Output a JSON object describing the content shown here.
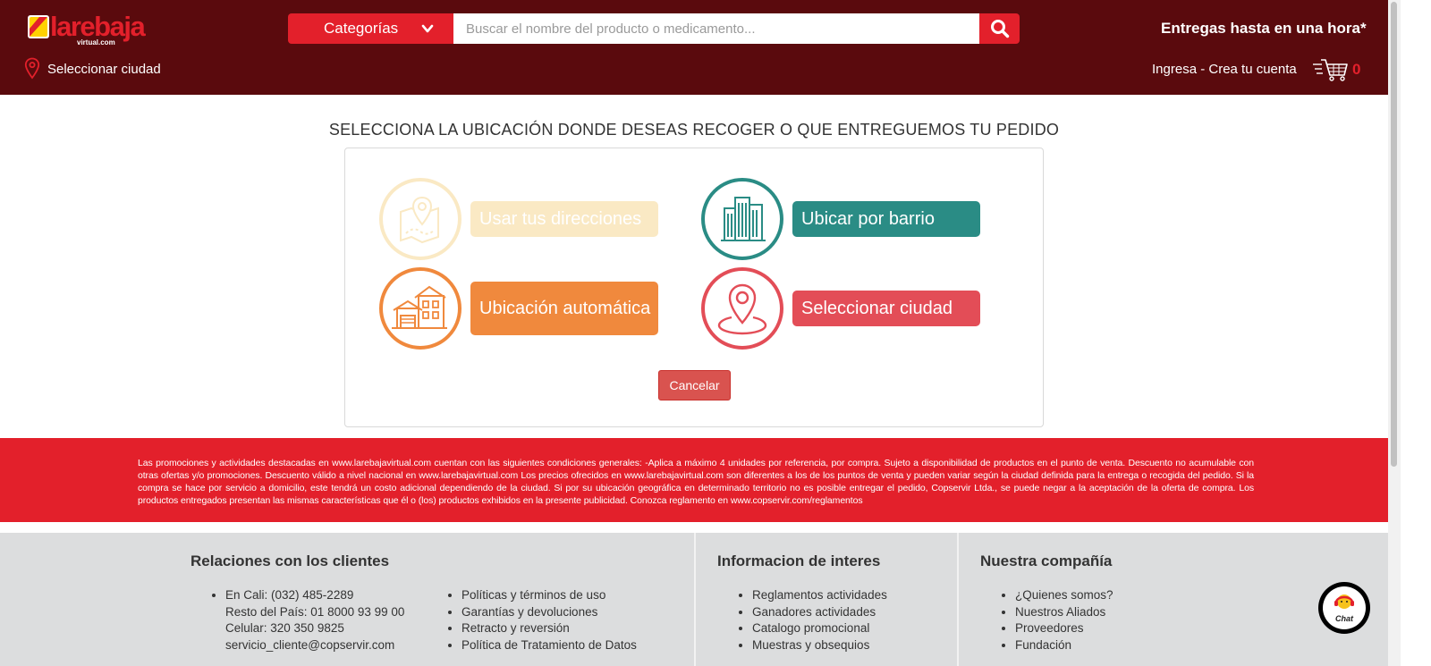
{
  "header": {
    "logo_text": "larebaja",
    "logo_sub": "virtual.com",
    "categories_label": "Categorías",
    "search_placeholder": "Buscar el nombre del producto o medicamento...",
    "delivery_text": "Entregas hasta en una hora*",
    "city_label": "Seleccionar ciudad",
    "login_label": "Ingresa - Crea tu cuenta",
    "cart_count": "0",
    "colors": {
      "bar": "#5a0a0d",
      "accent": "#e3202b"
    }
  },
  "main": {
    "heading": "SELECCIONA LA UBICACIÓN DONDE DESEAS RECOGER O QUE ENTREGUEMOS TU PEDIDO",
    "options": [
      {
        "label": "Usar tus direcciones",
        "icon": "map-pin-icon",
        "color": "#fae9c4"
      },
      {
        "label": "Ubicar por barrio",
        "icon": "buildings-icon",
        "color": "#2a8c85"
      },
      {
        "label": "Ubicación automática",
        "icon": "houses-icon",
        "color": "#f0893d"
      },
      {
        "label": "Seleccionar ciudad",
        "icon": "location-pin-icon",
        "color": "#e34d57"
      }
    ],
    "cancel_label": "Cancelar"
  },
  "legal_text": "Las promociones y actividades destacadas en www.larebajavirtual.com cuentan con las siguientes condiciones generales: -Aplica a máximo 4 unidades por referencia, por compra. Sujeto a disponibilidad de productos en el punto de venta. Descuento no acumulable con otras ofertas y/o promociones. Descuento válido a nivel nacional en www.larebajavirtual.com Los precios ofrecidos en www.larebajavirtual.com son diferentes a los de los puntos de venta y pueden variar según la ciudad definida para la entrega o recogida del pedido. Si la compra se hace por servicio a domicilio, este tendrá un costo adicional dependiendo de la ciudad. Si por su ubicación geográfica en determinado territorio no es posible entregar el pedido, Copservir Ltda., se puede negar a la aceptación de la oferta de compra. Los productos entregados presentan las mismas características que él o (los) productos exhibidos en la presente publicidad. Conozca reglamento en www.copservir.com/reglamentos",
  "footer": {
    "col1": {
      "title": "Relaciones con los clientes",
      "contact": [
        "En Cali: (032) 485-2289",
        "Resto del País: 01 8000 93 99 00",
        "Celular: 320 350 9825",
        "servicio_cliente@copservir.com"
      ],
      "links": [
        "Políticas y términos de uso",
        "Garantías y devoluciones",
        "Retracto y reversión",
        "Política de Tratamiento de Datos"
      ]
    },
    "col2": {
      "title": "Informacion de interes",
      "links": [
        "Reglamentos actividades",
        "Ganadores actividades",
        "Catalogo promocional",
        "Muestras y obsequios"
      ]
    },
    "col3": {
      "title": "Nuestra compañía",
      "links": [
        "¿Quienes somos?",
        "Nuestros Aliados",
        "Proveedores",
        "Fundación"
      ]
    }
  },
  "chat_label": "Chat"
}
